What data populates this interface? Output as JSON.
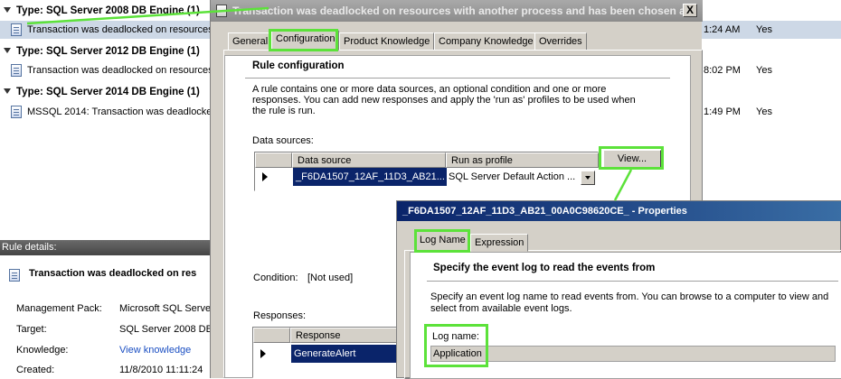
{
  "list": {
    "groups": [
      {
        "label": "Type: SQL Server 2008 DB Engine (1)",
        "row": {
          "name": "Transaction was deadlocked on resources",
          "time": "1:24 AM",
          "flag": "Yes",
          "selected": true
        }
      },
      {
        "label": "Type: SQL Server 2012 DB Engine (1)",
        "row": {
          "name": "Transaction was deadlocked on resources",
          "time": "8:02 PM",
          "flag": "Yes",
          "selected": false
        }
      },
      {
        "label": "Type: SQL Server 2014 DB Engine (1)",
        "row": {
          "name": "MSSQL 2014: Transaction was deadlocked",
          "time": "1:49 PM",
          "flag": "Yes",
          "selected": false
        }
      }
    ]
  },
  "details": {
    "header": "Rule details:",
    "title": "Transaction was deadlocked on res",
    "fields": [
      {
        "label": "Management Pack:",
        "value": "Microsoft SQL Server"
      },
      {
        "label": "Target:",
        "value": "SQL Server 2008 DB"
      },
      {
        "label": "Knowledge:",
        "value": "View knowledge",
        "link": true
      },
      {
        "label": "Created:",
        "value": "11/8/2010 11:11:24"
      }
    ]
  },
  "dialog": {
    "title": "Transaction was deadlocked on resources with another process and has been chosen a...",
    "close_label": "X",
    "tabs": [
      {
        "label": "General",
        "active": false
      },
      {
        "label": "Configuration",
        "active": true
      },
      {
        "label": "Product Knowledge",
        "active": false
      },
      {
        "label": "Company Knowledge",
        "active": false
      },
      {
        "label": "Overrides",
        "active": false
      }
    ],
    "section_title": "Rule configuration",
    "description": "A rule contains one or more data sources, an optional condition and one or more responses. You can add new responses and apply the 'run as' profiles to be used when the rule is run.",
    "data_sources_label": "Data sources:",
    "ds_columns": [
      "Data source",
      "Run as profile"
    ],
    "ds_row": {
      "source": "_F6DA1507_12AF_11D3_AB21...",
      "profile": "SQL Server Default Action ..."
    },
    "view_button": "View...",
    "condition_label": "Condition:",
    "condition_value": "[Not used]",
    "responses_label": "Responses:",
    "resp_columns": [
      "Response"
    ],
    "resp_row": "GenerateAlert"
  },
  "props": {
    "title": "_F6DA1507_12AF_11D3_AB21_00A0C98620CE_ - Properties",
    "tabs": [
      {
        "label": "Log Name",
        "active": true
      },
      {
        "label": "Expression",
        "active": false
      }
    ],
    "section_title": "Specify the event log to read the events from",
    "description": "Specify an event log name to read events from. You can browse to a computer to view and select from available event logs.",
    "log_name_label": "Log name:",
    "log_name_value": "Application"
  },
  "colors": {
    "highlight": "#5ce23a",
    "selection": "#0a246a",
    "link": "#1a4ec2"
  }
}
